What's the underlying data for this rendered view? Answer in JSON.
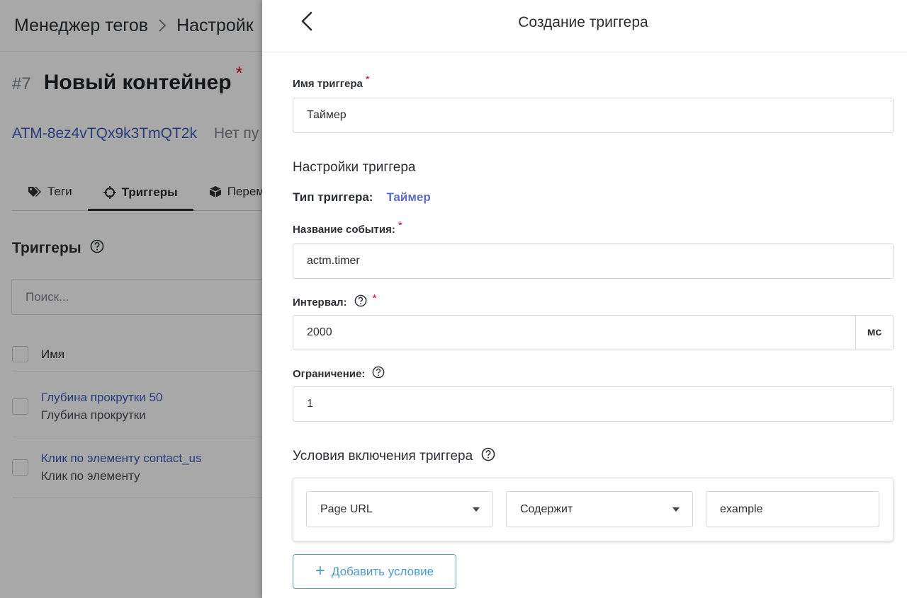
{
  "background": {
    "breadcrumb": [
      "Менеджер тегов",
      "Настройк"
    ],
    "container": {
      "number": "#7",
      "name": "Новый контейнер",
      "required_mark": "*",
      "id": "ATM-8ez4vTQx9k3TmQT2k",
      "status": "Нет пу"
    },
    "tabs": [
      {
        "label": "Теги",
        "icon": "tags-icon",
        "active": false
      },
      {
        "label": "Триггеры",
        "icon": "crosshair-icon",
        "active": true
      },
      {
        "label": "Перем",
        "icon": "cube-icon",
        "active": false
      }
    ],
    "section_title": "Триггеры",
    "search_placeholder": "Поиск...",
    "list_header": "Имя",
    "rows": [
      {
        "name": "Глубина прокрутки 50",
        "type": "Глубина прокрутки"
      },
      {
        "name": "Клик по элементу contact_us",
        "type": "Клик по элементу"
      }
    ]
  },
  "drawer": {
    "title": "Создание триггера",
    "back_icon": "chevron-left-icon",
    "required_mark": "*",
    "trigger_name": {
      "label": "Имя триггера",
      "value": "Таймер"
    },
    "settings_title": "Настройки триггера",
    "trigger_type": {
      "label": "Тип триггера:",
      "value": "Таймер"
    },
    "event_name": {
      "label": "Название события:",
      "value": "actm.timer"
    },
    "interval": {
      "label": "Интервал:",
      "value": "2000",
      "unit": "мс"
    },
    "limit": {
      "label": "Ограничение:",
      "value": "1"
    },
    "conditions": {
      "title": "Условия включения триггера",
      "variable": "Page URL",
      "operator": "Содержит",
      "value": "example",
      "add_button": "Добавить условие",
      "add_icon": "+"
    }
  },
  "colors": {
    "link": "#3d5bb8",
    "type_value": "#5c6fc4",
    "add_button": "#4b9bc6",
    "required": "#c8102e",
    "overlay": "rgba(0,0,0,0.34)"
  }
}
